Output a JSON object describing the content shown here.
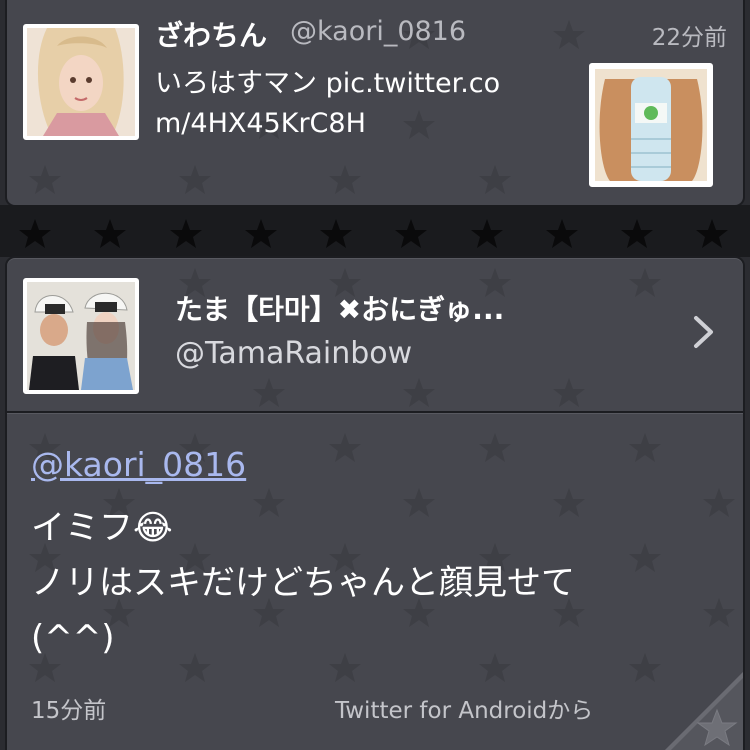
{
  "previous_tweet": {
    "name": "ざわちん",
    "handle": "@kaori_0816",
    "time": "22分前",
    "text": "いろはすマン pic.twitter.com/4HX45KrC8H"
  },
  "user": {
    "name": "たま【타마】✖おにぎゅ...",
    "handle": "@TamaRainbow"
  },
  "tweet": {
    "mention": "@kaori_0816",
    "lines": [
      "イミフ😂",
      "ノリはスキだけどちゃんと顔見せて",
      "(^^)"
    ],
    "time": "15分前",
    "source": "Twitter for Androidから"
  },
  "icons": {
    "chevron": "chevron-right-icon",
    "favorite": "star-icon"
  },
  "colors": {
    "panel": "#46474e",
    "link": "#a9b8ee",
    "muted": "#b9bac0"
  }
}
